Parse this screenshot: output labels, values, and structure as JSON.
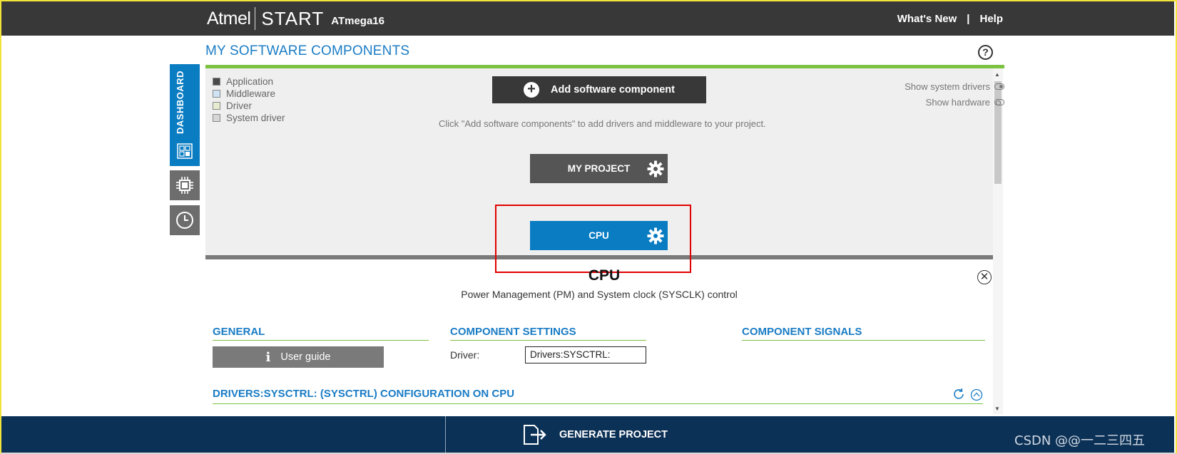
{
  "header": {
    "logo_brand": "Atmel",
    "logo_product": "START",
    "device": "ATmega16",
    "links": [
      "What's New",
      "Help"
    ],
    "separator": "|"
  },
  "page": {
    "title": "MY SOFTWARE COMPONENTS",
    "help_glyph": "?"
  },
  "sidebar": {
    "dashboard_label": "DASHBOARD",
    "items": [
      {
        "name": "dashboard-icon"
      },
      {
        "name": "chip-icon"
      },
      {
        "name": "clock-icon"
      }
    ]
  },
  "legend": [
    {
      "label": "Application",
      "color": "#4a4a4a"
    },
    {
      "label": "Middleware",
      "color": "#cfe3f3"
    },
    {
      "label": "Driver",
      "color": "#e6ecd0"
    },
    {
      "label": "System driver",
      "color": "#d6d6d6"
    }
  ],
  "components": {
    "add_button": "Add software component",
    "hint": "Click \"Add software components\" to add drivers and middleware to your project.",
    "show_system_drivers": "Show system drivers",
    "show_hardware": "Show hardware",
    "project_label": "MY PROJECT",
    "cpu_label": "CPU"
  },
  "details": {
    "title": "CPU",
    "subtitle": "Power Management (PM) and System clock (SYSCLK) control",
    "close_glyph": "✕",
    "general_head": "GENERAL",
    "user_guide": "User guide",
    "settings_head": "COMPONENT SETTINGS",
    "driver_label": "Driver:",
    "driver_value": "Drivers:SYSCTRL:",
    "signals_head": "COMPONENT SIGNALS",
    "config_head": "DRIVERS:SYSCTRL: (SYSCTRL) CONFIGURATION ON CPU"
  },
  "footer": {
    "generate": "GENERATE PROJECT"
  },
  "watermark": "CSDN @@一二三四五",
  "colors": {
    "accent_blue": "#0a7cc2",
    "accent_green": "#7dc242",
    "header_dark": "#383838",
    "footer_navy": "#0c3156",
    "highlight_red": "#e00000"
  }
}
